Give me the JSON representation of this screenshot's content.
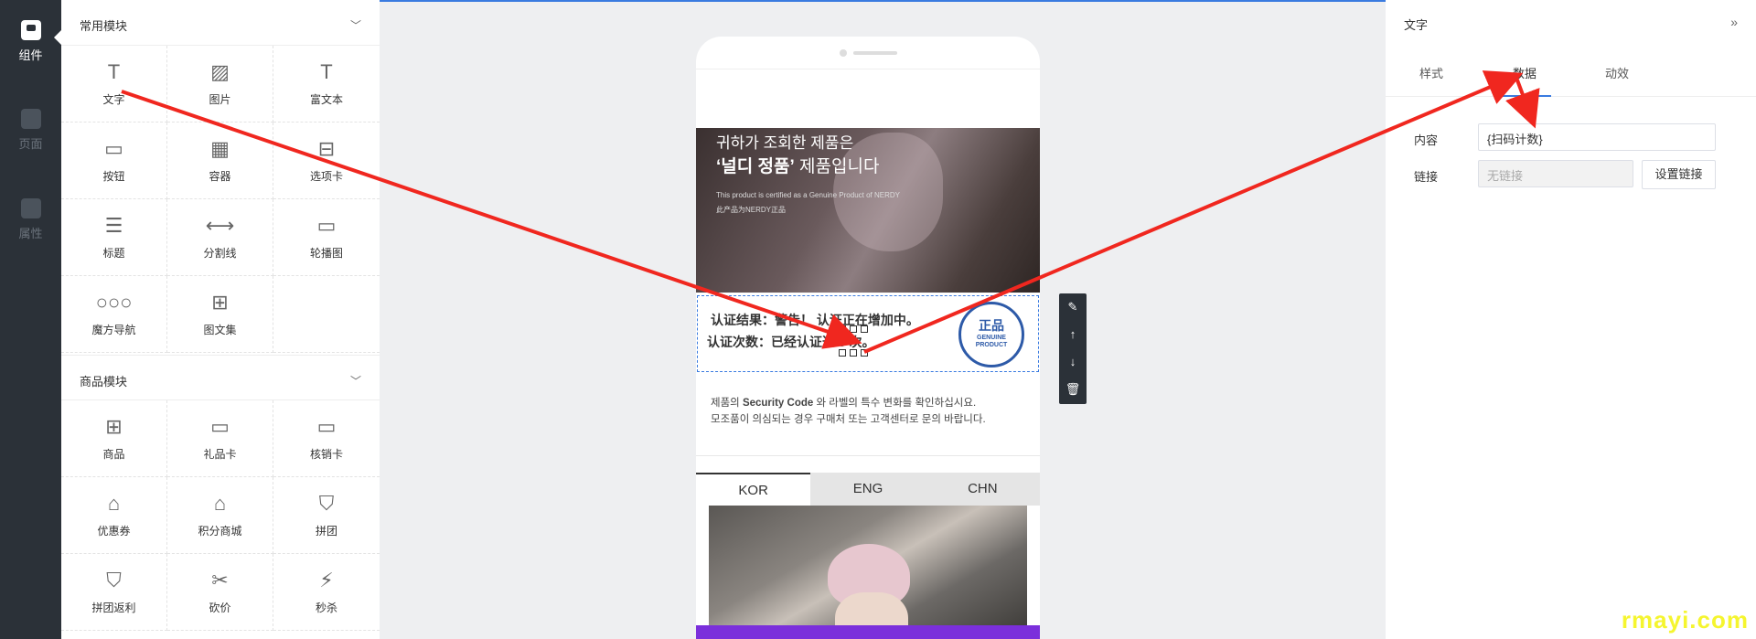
{
  "nav": {
    "items": [
      {
        "label": "组件",
        "icon": "component-icon"
      },
      {
        "label": "页面",
        "icon": "page-icon"
      },
      {
        "label": "属性",
        "icon": "property-icon"
      }
    ]
  },
  "panel": {
    "common": {
      "title": "常用模块",
      "items": [
        {
          "label": "文字",
          "icon": "text-icon",
          "glyph": "T"
        },
        {
          "label": "图片",
          "icon": "image-icon",
          "glyph": "▨"
        },
        {
          "label": "富文本",
          "icon": "rich-text-icon",
          "glyph": "T"
        },
        {
          "label": "按钮",
          "icon": "button-icon",
          "glyph": "▭"
        },
        {
          "label": "容器",
          "icon": "container-icon",
          "glyph": "▦"
        },
        {
          "label": "选项卡",
          "icon": "tab-icon",
          "glyph": "⊟"
        },
        {
          "label": "标题",
          "icon": "title-icon",
          "glyph": "☰"
        },
        {
          "label": "分割线",
          "icon": "divider-icon",
          "glyph": "⟷"
        },
        {
          "label": "轮播图",
          "icon": "carousel-icon",
          "glyph": "▭"
        },
        {
          "label": "魔方导航",
          "icon": "cube-nav-icon",
          "glyph": "○○○"
        },
        {
          "label": "图文集",
          "icon": "gallery-icon",
          "glyph": "⊞"
        },
        {
          "label": "",
          "icon": "",
          "glyph": ""
        }
      ]
    },
    "goods": {
      "title": "商品模块",
      "items": [
        {
          "label": "商品",
          "icon": "goods-icon",
          "glyph": "⊞"
        },
        {
          "label": "礼品卡",
          "icon": "gift-card-icon",
          "glyph": "▭"
        },
        {
          "label": "核销卡",
          "icon": "verify-card-icon",
          "glyph": "▭"
        },
        {
          "label": "优惠券",
          "icon": "coupon-icon",
          "glyph": "⌂"
        },
        {
          "label": "积分商城",
          "icon": "points-mall-icon",
          "glyph": "⌂"
        },
        {
          "label": "拼团",
          "icon": "group-buy-icon",
          "glyph": "⛉"
        },
        {
          "label": "拼团返利",
          "icon": "group-rebate-icon",
          "glyph": "⛉"
        },
        {
          "label": "砍价",
          "icon": "bargain-icon",
          "glyph": "✂"
        },
        {
          "label": "秒杀",
          "icon": "flash-sale-icon",
          "glyph": "⚡"
        }
      ]
    }
  },
  "phone": {
    "hero": {
      "line1": "귀하가 조회한 제품은",
      "line2_bold": "‘널디 정품’",
      "line2_rest": " 제품입니다",
      "line3": "This product is certified as a Genuine Product of NERDY",
      "line4": "此产品为NERDY正品"
    },
    "result": {
      "line1": "认证结果：警告！ 认证正在增加中。",
      "line2": "认证次数：已经认证过 0 次。"
    },
    "seal": {
      "main": "正品",
      "sub1": "GENUINE",
      "sub2": "PRODUCT"
    },
    "desc": {
      "l1_pre": "제품의 ",
      "l1_bold": "Security Code",
      "l1_post": " 와 라벨의 특수 변화를 확인하십시요.",
      "l2": "모조품이 의심되는 경우 구매처 또는 고객센터로 문의 바랍니다."
    },
    "langs": [
      "KOR",
      "ENG",
      "CHN"
    ],
    "active_lang": "KOR"
  },
  "toolbar": {
    "items": [
      "edit-icon",
      "move-up-icon",
      "move-down-icon",
      "delete-icon"
    ],
    "glyphs": [
      "✎",
      "↑",
      "↓",
      "🗑"
    ]
  },
  "right": {
    "title": "文字",
    "tabs": [
      "样式",
      "数据",
      "动效"
    ],
    "active_tab": "数据",
    "content_label": "内容",
    "content_value": "{扫码计数}",
    "link_label": "链接",
    "link_placeholder": "无链接",
    "link_button": "设置链接"
  },
  "watermark": "rmayi.com",
  "colors": {
    "accent": "#3a7be0",
    "arrow": "#f0271f",
    "nav": "#2b3138",
    "purple": "#7b2fdb"
  }
}
